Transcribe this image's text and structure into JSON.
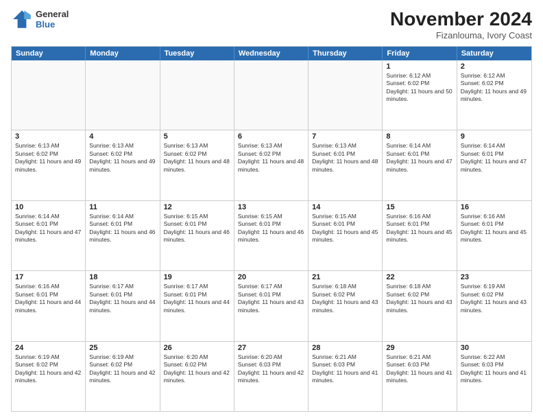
{
  "logo": {
    "line1": "General",
    "line2": "Blue"
  },
  "title": "November 2024",
  "location": "Fizanlouma, Ivory Coast",
  "days_of_week": [
    "Sunday",
    "Monday",
    "Tuesday",
    "Wednesday",
    "Thursday",
    "Friday",
    "Saturday"
  ],
  "weeks": [
    [
      {
        "day": "",
        "empty": true
      },
      {
        "day": "",
        "empty": true
      },
      {
        "day": "",
        "empty": true
      },
      {
        "day": "",
        "empty": true
      },
      {
        "day": "",
        "empty": true
      },
      {
        "day": "1",
        "sunrise": "6:12 AM",
        "sunset": "6:02 PM",
        "daylight": "11 hours and 50 minutes."
      },
      {
        "day": "2",
        "sunrise": "6:12 AM",
        "sunset": "6:02 PM",
        "daylight": "11 hours and 49 minutes."
      }
    ],
    [
      {
        "day": "3",
        "sunrise": "6:13 AM",
        "sunset": "6:02 PM",
        "daylight": "11 hours and 49 minutes."
      },
      {
        "day": "4",
        "sunrise": "6:13 AM",
        "sunset": "6:02 PM",
        "daylight": "11 hours and 49 minutes."
      },
      {
        "day": "5",
        "sunrise": "6:13 AM",
        "sunset": "6:02 PM",
        "daylight": "11 hours and 48 minutes."
      },
      {
        "day": "6",
        "sunrise": "6:13 AM",
        "sunset": "6:02 PM",
        "daylight": "11 hours and 48 minutes."
      },
      {
        "day": "7",
        "sunrise": "6:13 AM",
        "sunset": "6:01 PM",
        "daylight": "11 hours and 48 minutes."
      },
      {
        "day": "8",
        "sunrise": "6:14 AM",
        "sunset": "6:01 PM",
        "daylight": "11 hours and 47 minutes."
      },
      {
        "day": "9",
        "sunrise": "6:14 AM",
        "sunset": "6:01 PM",
        "daylight": "11 hours and 47 minutes."
      }
    ],
    [
      {
        "day": "10",
        "sunrise": "6:14 AM",
        "sunset": "6:01 PM",
        "daylight": "11 hours and 47 minutes."
      },
      {
        "day": "11",
        "sunrise": "6:14 AM",
        "sunset": "6:01 PM",
        "daylight": "11 hours and 46 minutes."
      },
      {
        "day": "12",
        "sunrise": "6:15 AM",
        "sunset": "6:01 PM",
        "daylight": "11 hours and 46 minutes."
      },
      {
        "day": "13",
        "sunrise": "6:15 AM",
        "sunset": "6:01 PM",
        "daylight": "11 hours and 46 minutes."
      },
      {
        "day": "14",
        "sunrise": "6:15 AM",
        "sunset": "6:01 PM",
        "daylight": "11 hours and 45 minutes."
      },
      {
        "day": "15",
        "sunrise": "6:16 AM",
        "sunset": "6:01 PM",
        "daylight": "11 hours and 45 minutes."
      },
      {
        "day": "16",
        "sunrise": "6:16 AM",
        "sunset": "6:01 PM",
        "daylight": "11 hours and 45 minutes."
      }
    ],
    [
      {
        "day": "17",
        "sunrise": "6:16 AM",
        "sunset": "6:01 PM",
        "daylight": "11 hours and 44 minutes."
      },
      {
        "day": "18",
        "sunrise": "6:17 AM",
        "sunset": "6:01 PM",
        "daylight": "11 hours and 44 minutes."
      },
      {
        "day": "19",
        "sunrise": "6:17 AM",
        "sunset": "6:01 PM",
        "daylight": "11 hours and 44 minutes."
      },
      {
        "day": "20",
        "sunrise": "6:17 AM",
        "sunset": "6:01 PM",
        "daylight": "11 hours and 43 minutes."
      },
      {
        "day": "21",
        "sunrise": "6:18 AM",
        "sunset": "6:02 PM",
        "daylight": "11 hours and 43 minutes."
      },
      {
        "day": "22",
        "sunrise": "6:18 AM",
        "sunset": "6:02 PM",
        "daylight": "11 hours and 43 minutes."
      },
      {
        "day": "23",
        "sunrise": "6:19 AM",
        "sunset": "6:02 PM",
        "daylight": "11 hours and 43 minutes."
      }
    ],
    [
      {
        "day": "24",
        "sunrise": "6:19 AM",
        "sunset": "6:02 PM",
        "daylight": "11 hours and 42 minutes."
      },
      {
        "day": "25",
        "sunrise": "6:19 AM",
        "sunset": "6:02 PM",
        "daylight": "11 hours and 42 minutes."
      },
      {
        "day": "26",
        "sunrise": "6:20 AM",
        "sunset": "6:02 PM",
        "daylight": "11 hours and 42 minutes."
      },
      {
        "day": "27",
        "sunrise": "6:20 AM",
        "sunset": "6:03 PM",
        "daylight": "11 hours and 42 minutes."
      },
      {
        "day": "28",
        "sunrise": "6:21 AM",
        "sunset": "6:03 PM",
        "daylight": "11 hours and 41 minutes."
      },
      {
        "day": "29",
        "sunrise": "6:21 AM",
        "sunset": "6:03 PM",
        "daylight": "11 hours and 41 minutes."
      },
      {
        "day": "30",
        "sunrise": "6:22 AM",
        "sunset": "6:03 PM",
        "daylight": "11 hours and 41 minutes."
      }
    ]
  ]
}
